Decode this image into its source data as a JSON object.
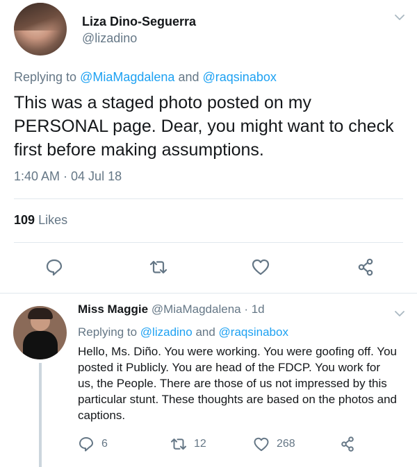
{
  "main_tweet": {
    "author_name": "Liza Dino-Seguerra",
    "author_handle": "@lizadino",
    "replying_prefix": "Replying to",
    "reply_user_1": "@MiaMagdalena",
    "reply_and": "and",
    "reply_user_2": "@raqsinabox",
    "body": "This was a staged photo posted on my PERSONAL page. Dear, you might want to check first before making assumptions.",
    "timestamp": "1:40 AM · 04 Jul 18",
    "likes_count": "109",
    "likes_label": "Likes",
    "actions": [
      "reply-icon",
      "retweet-icon",
      "like-icon",
      "share-icon"
    ]
  },
  "reply_tweet": {
    "author_name": "Miss Maggie",
    "author_handle": "@MiaMagdalena",
    "age": "· 1d",
    "replying_prefix": "Replying to",
    "reply_user_1": "@lizadino",
    "reply_and": "and",
    "reply_user_2": "@raqsinabox",
    "body": "Hello, Ms. Diño. You were working. You were goofing off. You posted it Publicly. You are head of the FDCP. You work for us, the People. There are those of us not impressed by this particular stunt. These thoughts are based on the photos and captions.",
    "reply_count": "6",
    "retweet_count": "12",
    "like_count": "268"
  },
  "colors": {
    "link": "#1da1f2",
    "secondary_text": "#657786",
    "divider": "#e1e8ed"
  }
}
